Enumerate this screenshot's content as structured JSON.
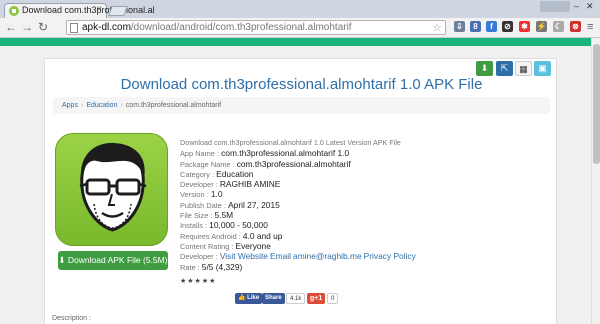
{
  "browser": {
    "tab_title": "Download com.th3professional.al",
    "tab_close": "×",
    "user_label": "",
    "url_host": "apk-dl.com",
    "url_path": "/download/android/com.th3professional.almohtarif",
    "icons": [
      "back-icon",
      "forward-icon",
      "reload-icon",
      "star-icon"
    ]
  },
  "page": {
    "title": "Download com.th3professional.almohtarif 1.0 APK File",
    "breadcrumb": {
      "items": [
        "Apps",
        "Education"
      ],
      "current": "com.th3professional.almohtarif",
      "separator": "›"
    },
    "download_button": "Download APK File (5.5M)",
    "info_heading": "Download com.th3professional.almohtarif 1.0 Latest Version APK File",
    "details": [
      {
        "label": "App Name :",
        "value": "com.th3professional.almohtarif 1.0"
      },
      {
        "label": "Package Name :",
        "value": "com.th3professional.almohtarif"
      },
      {
        "label": "Category :",
        "value": "Education"
      },
      {
        "label": "Developer :",
        "value": "RAGHIB AMINE"
      },
      {
        "label": "Version :",
        "value": "1.0"
      },
      {
        "label": "Publish Date :",
        "value": "April 27, 2015"
      },
      {
        "label": "File Size :",
        "value": "5.5M"
      },
      {
        "label": "Installs :",
        "value": "10,000 - 50,000"
      },
      {
        "label": "Requires Android :",
        "value": "4.0 and up"
      },
      {
        "label": "Content Rating :",
        "value": "Everyone"
      }
    ],
    "developer_links": {
      "label": "Developer :",
      "website": "Visit Website",
      "email_label": "Email",
      "email": "amine@raghib.me",
      "privacy": "Privacy Policy"
    },
    "rate": {
      "label": "Rate :",
      "value": "5/5 (4,329)"
    },
    "stars": "★★★★★",
    "social": {
      "like": "Like",
      "share": "Share",
      "fb_count": "4.1k",
      "gplus": "g+1",
      "gplus_count": "0"
    },
    "description_label": "Description :"
  },
  "colors": {
    "accent_green": "#1ab37a",
    "title_blue": "#2f6fa8",
    "download_green": "#3f9c40"
  }
}
